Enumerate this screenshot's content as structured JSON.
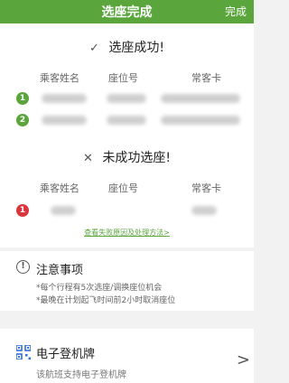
{
  "nav": {
    "title": "选座完成",
    "action": "完成"
  },
  "success": {
    "title": "选座成功!",
    "mark": "✓",
    "columns": [
      "乘客姓名",
      "座位号",
      "常客卡"
    ],
    "rows": [
      {
        "index": "1"
      },
      {
        "index": "2"
      }
    ]
  },
  "failure": {
    "title": "未成功选座!",
    "mark": "✕",
    "columns": [
      "乘客姓名",
      "座位号",
      "常客卡"
    ],
    "rows": [
      {
        "index": "1"
      }
    ],
    "link": "查看失败原因及处理方法>"
  },
  "notice": {
    "icon": "!",
    "title": "注意事项",
    "lines": [
      "*每个行程有5次选座/调换座位机会",
      "*最晚在计划起飞时间前2小时取消座位"
    ]
  },
  "boarding": {
    "title": "电子登机牌",
    "subtitle": "该航班支持电子登机牌",
    "chevron": ">"
  },
  "colors": {
    "accent": "#5aa53c",
    "error": "#d9363e"
  }
}
